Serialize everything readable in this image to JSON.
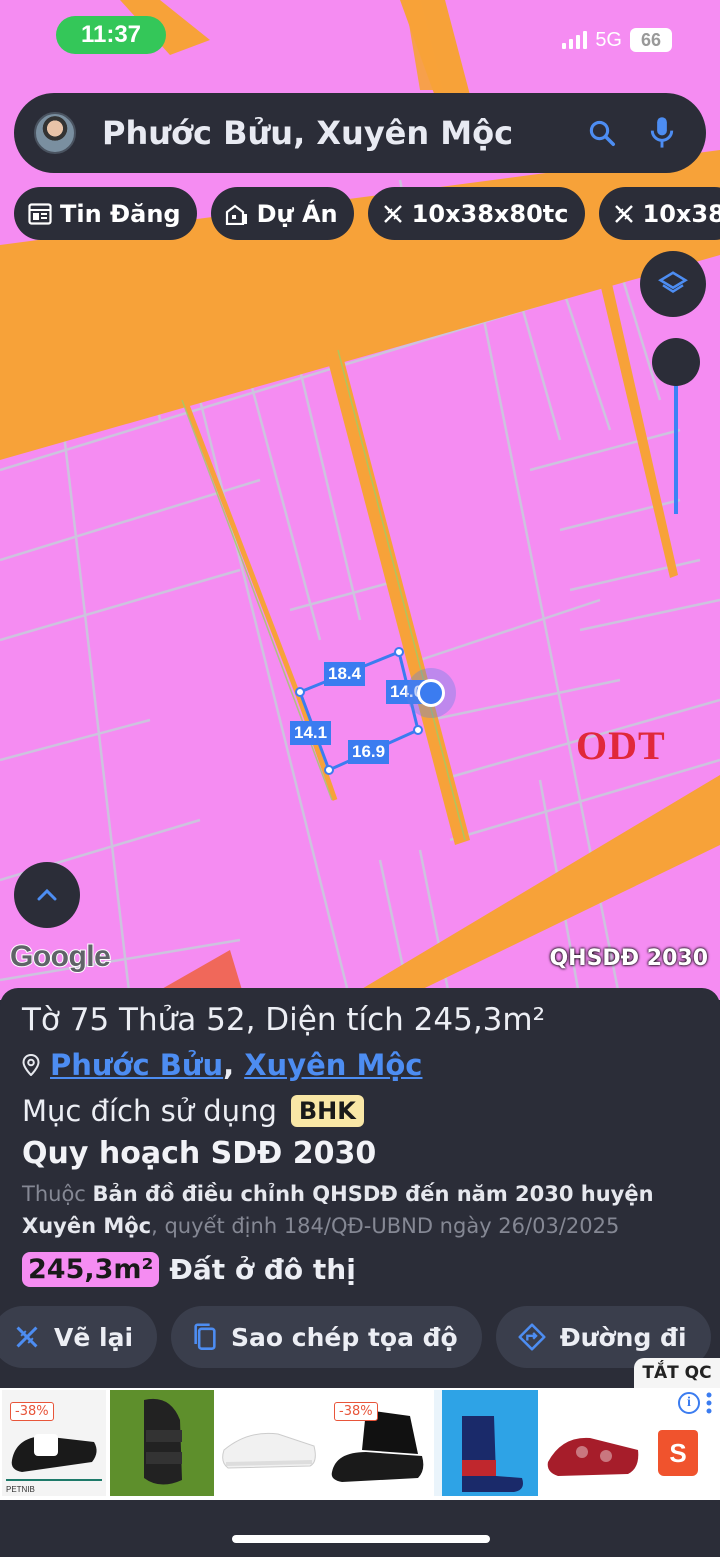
{
  "status_bar": {
    "time": "11:37",
    "network": "5G",
    "battery": "66"
  },
  "search": {
    "query": "Phước Bửu, Xuyên Mộc"
  },
  "chips": [
    {
      "label": "Tin Đăng",
      "icon": "news-icon"
    },
    {
      "label": "Dự Án",
      "icon": "building-icon"
    },
    {
      "label": "10x38x80tc",
      "icon": "ruler-pencil-icon"
    },
    {
      "label": "10x38",
      "icon": "ruler-pencil-icon"
    }
  ],
  "map": {
    "zone_label": "ODT",
    "attribution": "Google",
    "source_label": "QHSDĐ 2030",
    "dimensions": [
      "18.4",
      "14.0",
      "14.1",
      "16.9"
    ],
    "colors": {
      "residential": "#f58cf2",
      "road": "#f7a239",
      "selection": "#3b7cf0"
    }
  },
  "parcel": {
    "title": "Tờ 75 Thửa 52, Diện tích 245,3m²",
    "ward": "Phước Bửu",
    "separator": ",",
    "district": "Xuyên Mộc",
    "purpose_label": "Mục đích sử dụng",
    "purpose_code": "BHK",
    "plan_title": "Quy hoạch SDĐ 2030",
    "plan_prefix": "Thuộc",
    "plan_name": "Bản đồ điều chỉnh QHSDĐ đến năm 2030 huyện Xuyên Mộc",
    "plan_decision": ", quyết định 184/QĐ-UBND ngày 26/03/2025",
    "area": "245,3m²",
    "land_type": "Đất ở đô thị"
  },
  "actions": [
    {
      "label": "Vẽ lại",
      "icon": "draw-icon"
    },
    {
      "label": "Sao chép tọa độ",
      "icon": "copy-icon"
    },
    {
      "label": "Đường đi",
      "icon": "directions-icon"
    }
  ],
  "ad": {
    "close_label": "TẮT QC",
    "discount_1": "-38%",
    "discount_2": "-38%",
    "brand_1": "PETNIB",
    "shop_letter": "S"
  }
}
